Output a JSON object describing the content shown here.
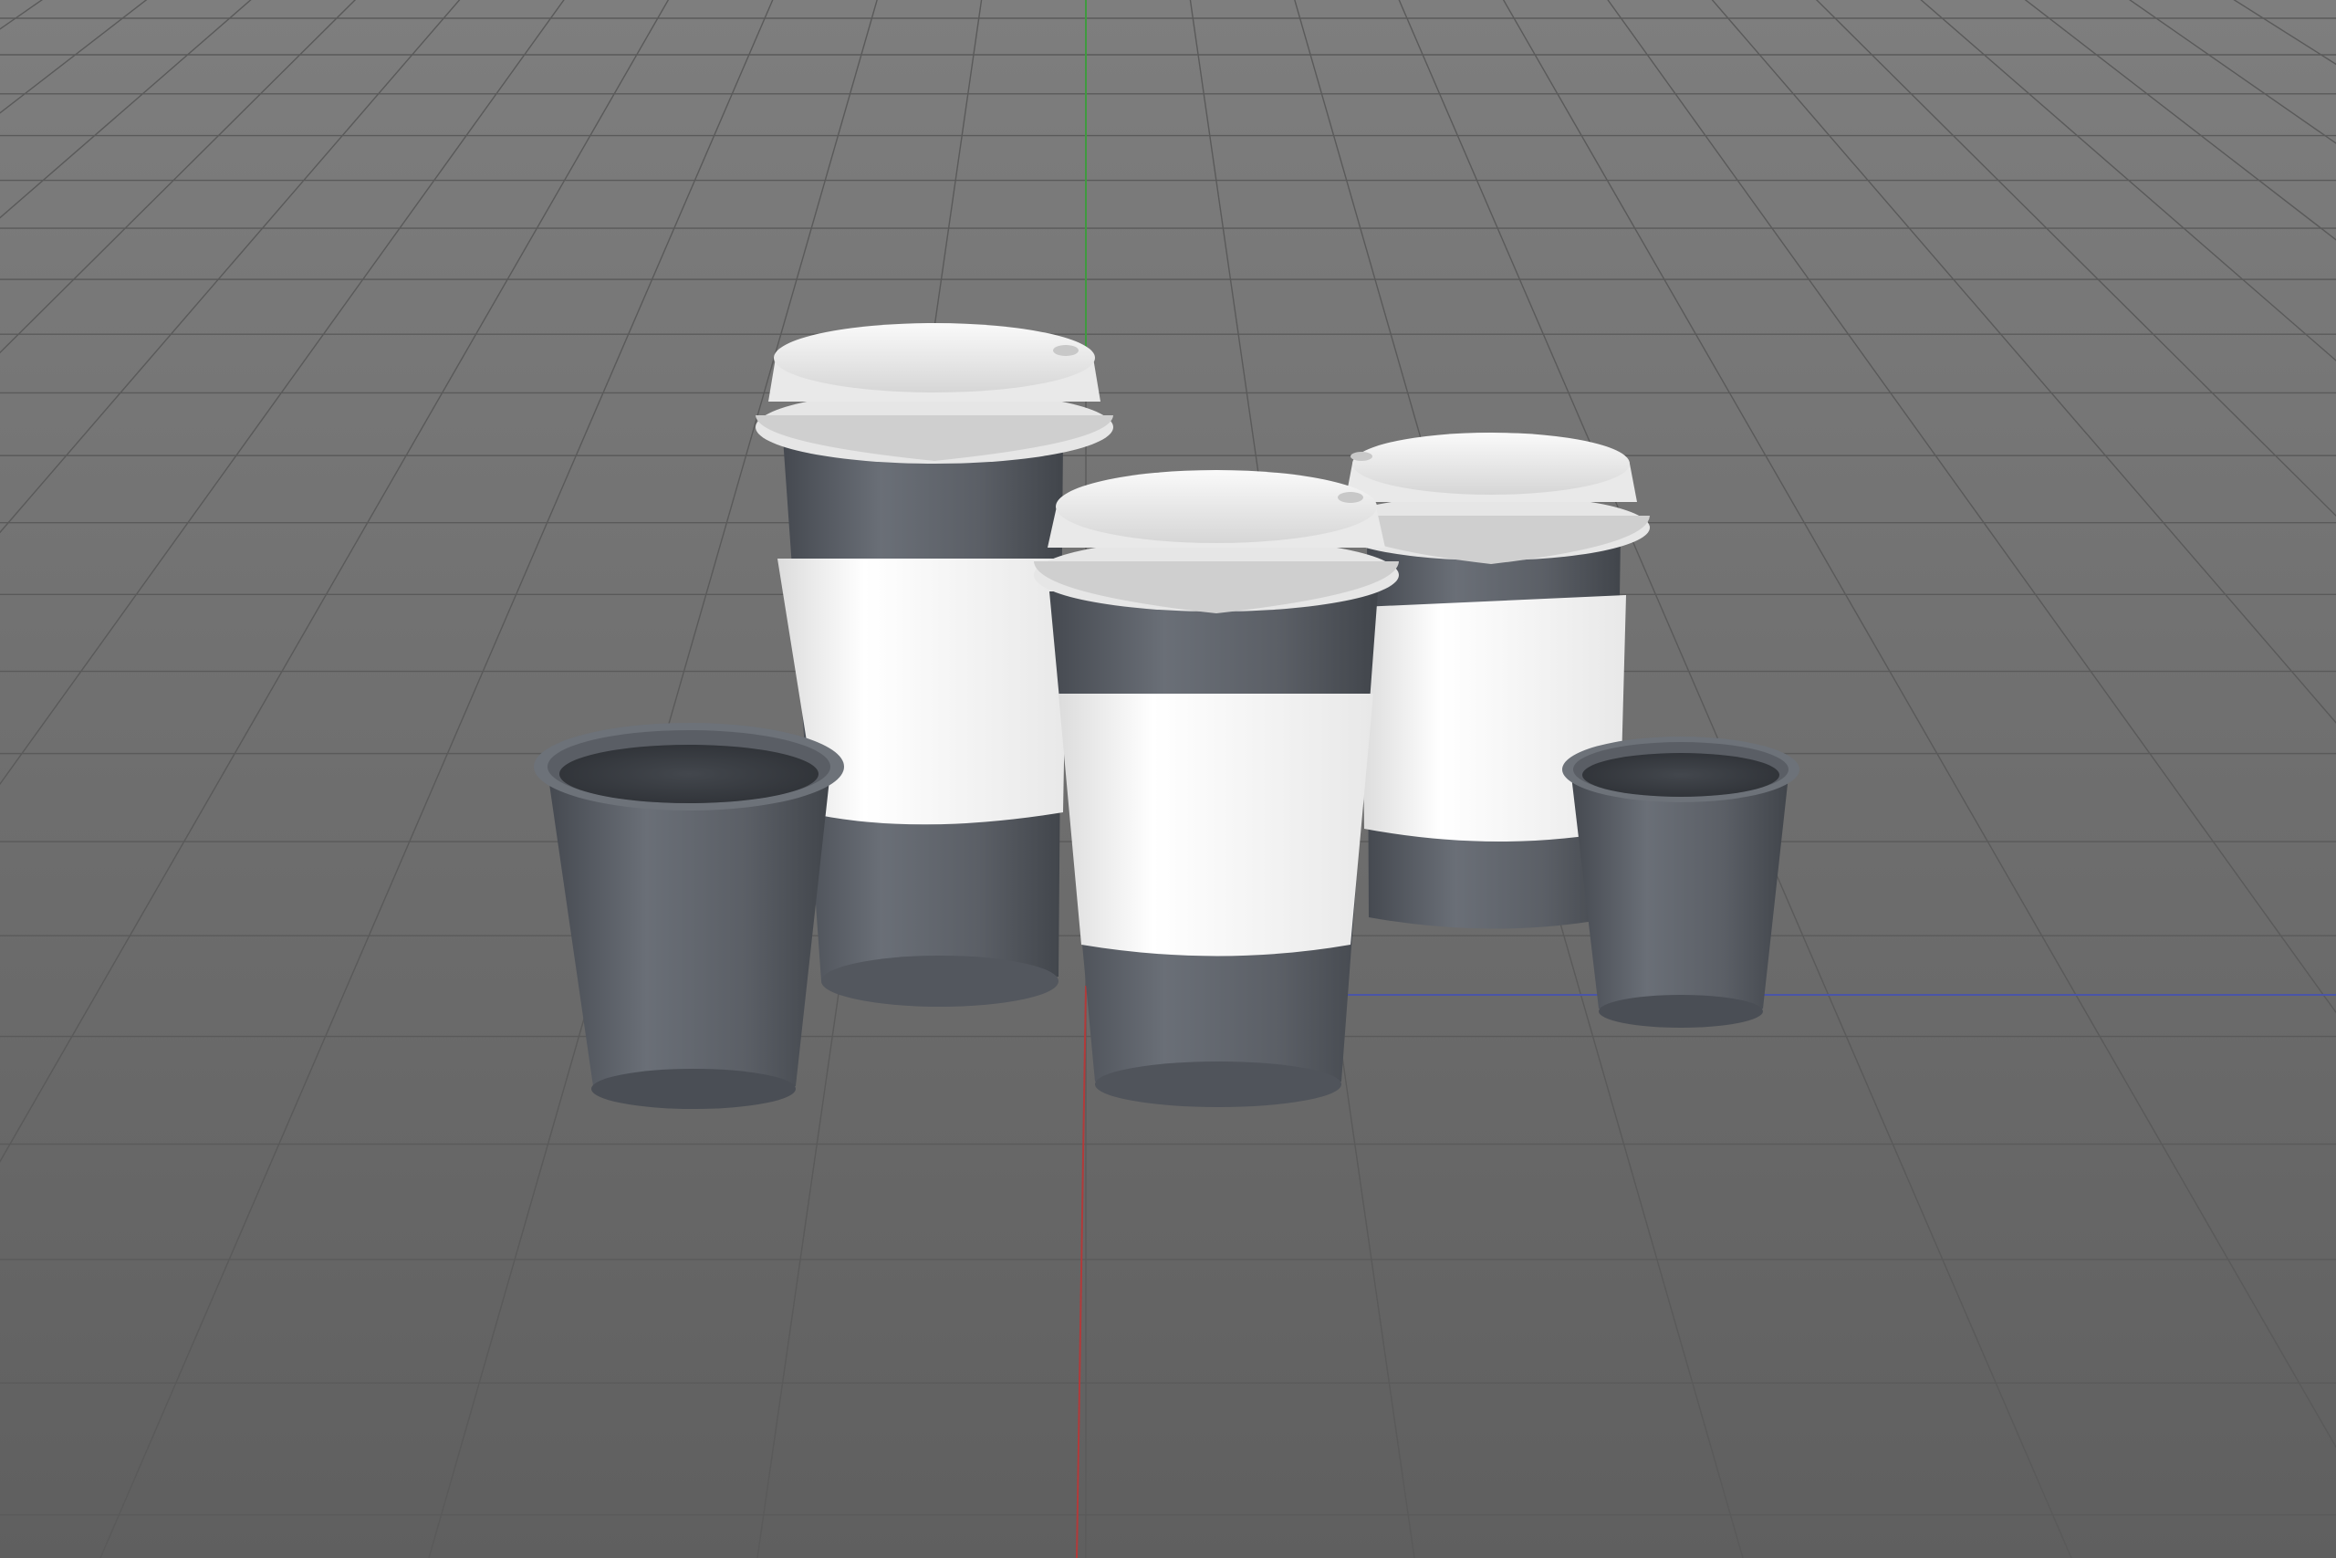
{
  "viewport": {
    "background_top": "#7e7e7e",
    "background_bottom": "#5f5f5f",
    "grid_color": "#5a5a5a",
    "axis_x_color": "#4a55a8",
    "axis_y_color": "#3f9a3f",
    "axis_z_color": "#b23a3a"
  },
  "materials": {
    "cup_dark": "#5b5f66",
    "cup_dark_shadow": "#454950",
    "cup_dark_highlight": "#7d828a",
    "sleeve": "#f2f2f2",
    "lid": "#f5f5f5",
    "lid_shade": "#d9d9d9"
  },
  "objects": [
    {
      "name": "cup-tall-back-left",
      "kind": "lidded-cup-with-sleeve"
    },
    {
      "name": "cup-tall-front-center",
      "kind": "lidded-cup-with-sleeve"
    },
    {
      "name": "cup-tall-back-right",
      "kind": "lidded-cup-with-sleeve"
    },
    {
      "name": "cup-small-left",
      "kind": "open-cup"
    },
    {
      "name": "cup-small-right",
      "kind": "open-cup"
    }
  ]
}
